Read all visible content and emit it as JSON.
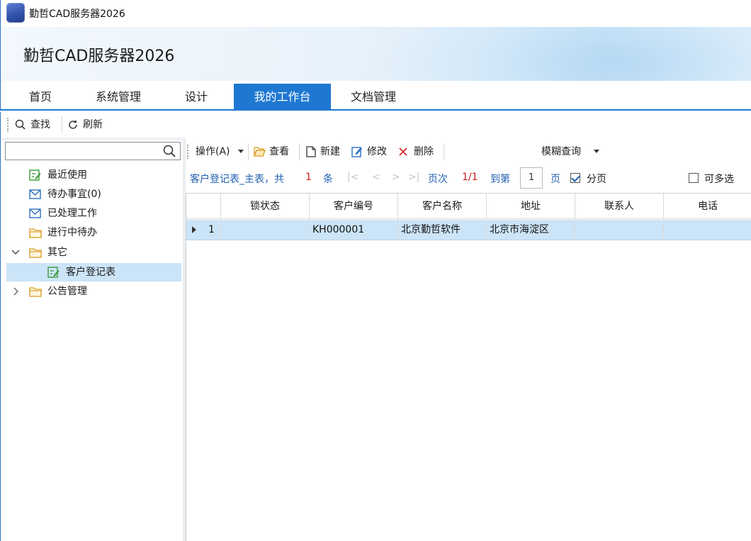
{
  "window": {
    "title": "勤哲CAD服务器2026"
  },
  "banner": {
    "title": "勤哲CAD服务器2026"
  },
  "tabs": [
    {
      "label": "首页"
    },
    {
      "label": "系统管理"
    },
    {
      "label": "设计"
    },
    {
      "label": "我的工作台"
    },
    {
      "label": "文档管理"
    }
  ],
  "active_tab": "我的工作台",
  "toolbar": {
    "find_label": "查找",
    "refresh_label": "刷新"
  },
  "sidebar": {
    "search_value": "",
    "items": [
      {
        "label": "最近使用",
        "icon": "edit-doc-icon"
      },
      {
        "label": "待办事宜(0)",
        "icon": "mail-icon"
      },
      {
        "label": "已处理工作",
        "icon": "mail-icon"
      },
      {
        "label": "进行中待办",
        "icon": "folder-icon"
      },
      {
        "label": "其它",
        "icon": "folder-icon",
        "expanded": true
      },
      {
        "label": "客户登记表",
        "icon": "edit-doc-icon",
        "selected": true
      },
      {
        "label": "公告管理",
        "icon": "folder-icon",
        "expanded": false
      }
    ]
  },
  "grid_toolbar": {
    "operate_label": "操作(A)",
    "view_label": "查看",
    "new_label": "新建",
    "edit_label": "修改",
    "delete_label": "删除",
    "fuzzy_label": "模糊查询"
  },
  "pager": {
    "table_label": "客户登记表_主表，共",
    "count": "1",
    "unit": "条",
    "first": "|<",
    "prev": "<",
    "next": ">",
    "last": ">|",
    "page_label": "页次",
    "page_value": "1/1",
    "goto_label": "到第",
    "goto_value": "1",
    "page_unit": "页",
    "paging_label": "分页",
    "paging_checked": true,
    "multi_label": "可多选",
    "multi_checked": false
  },
  "table": {
    "columns": [
      "锁状态",
      "客户编号",
      "客户名称",
      "地址",
      "联系人",
      "电话"
    ],
    "rows": [
      {
        "index": "1",
        "cells": [
          "",
          "KH000001",
          "北京勤哲软件",
          "北京市海淀区",
          "",
          ""
        ]
      }
    ]
  },
  "colors": {
    "accent": "#1e78d2",
    "link": "#1f5fb0",
    "count": "#d01f1f",
    "selection": "#cce4f7"
  }
}
